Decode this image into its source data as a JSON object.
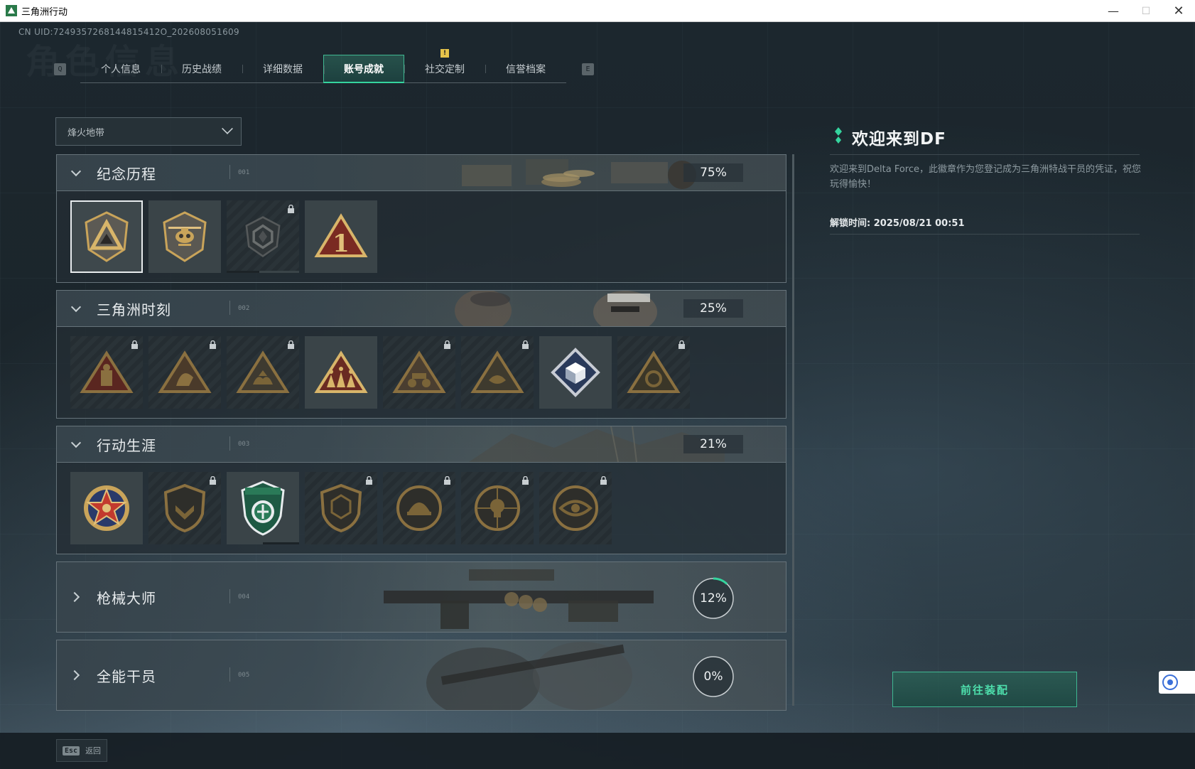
{
  "window": {
    "title": "三角洲行动",
    "controls": [
      "minimize-icon",
      "maximize-icon",
      "close-icon"
    ]
  },
  "uid": "CN UID:7249357268144815412O_202608051609",
  "background_title": "角色信息",
  "tabs": {
    "left_key": "Q",
    "right_key": "E",
    "items": [
      {
        "label": "个人信息",
        "active": false
      },
      {
        "label": "历史战绩",
        "active": false
      },
      {
        "label": "详细数据",
        "active": false
      },
      {
        "label": "账号成就",
        "active": true
      },
      {
        "label": "社交定制",
        "active": false,
        "alert": "!"
      },
      {
        "label": "信誉档案",
        "active": false
      }
    ]
  },
  "mode_select": {
    "value": "烽火地带"
  },
  "categories": [
    {
      "name": "纪念历程",
      "code": "001",
      "percent": "75%",
      "expanded": true,
      "badges": [
        {
          "icon": "delta-shield-badge-icon",
          "locked": false,
          "selected": true
        },
        {
          "icon": "helicopter-badge-icon",
          "locked": false
        },
        {
          "icon": "hex-emblem-badge-icon",
          "locked": true,
          "progress": 0.45
        },
        {
          "icon": "number-one-triangle-badge-icon",
          "locked": false
        }
      ]
    },
    {
      "name": "三角洲时刻",
      "code": "002",
      "percent": "25%",
      "expanded": true,
      "badges": [
        {
          "icon": "triangle-operator-badge-icon",
          "locked": true
        },
        {
          "icon": "triangle-runner-badge-icon",
          "locked": true
        },
        {
          "icon": "triangle-hands-badge-icon",
          "locked": true
        },
        {
          "icon": "triangle-squad-badge-icon",
          "locked": false
        },
        {
          "icon": "triangle-rider-badge-icon",
          "locked": true
        },
        {
          "icon": "triangle-fish-badge-icon",
          "locked": true
        },
        {
          "icon": "diamond-cube-badge-icon",
          "locked": false
        },
        {
          "icon": "triangle-mask-badge-icon",
          "locked": true
        }
      ]
    },
    {
      "name": "行动生涯",
      "code": "003",
      "percent": "21%",
      "expanded": true,
      "badges": [
        {
          "icon": "star-medal-badge-icon",
          "locked": false
        },
        {
          "icon": "shield-chevron-badge-icon",
          "locked": true
        },
        {
          "icon": "green-shield-badge-icon",
          "locked": false,
          "progress": 0.55
        },
        {
          "icon": "shield-hex-badge-icon",
          "locked": true
        },
        {
          "icon": "circle-helmet-badge-icon",
          "locked": true
        },
        {
          "icon": "circle-skull-badge-icon",
          "locked": true
        },
        {
          "icon": "circle-eye-badge-icon",
          "locked": true
        }
      ]
    },
    {
      "name": "枪械大师",
      "code": "004",
      "percent": "12%",
      "progress": 0.12,
      "expanded": false
    },
    {
      "name": "全能干员",
      "code": "005",
      "percent": "0%",
      "progress": 0,
      "expanded": false
    }
  ],
  "detail": {
    "title": "欢迎来到DF",
    "description": "欢迎来到Delta Force，此徽章作为您登记成为三角洲特战干员的凭证，祝您玩得愉快！",
    "unlock_label": "解锁时间: 2025/08/21 00:51",
    "equip_button": "前往装配"
  },
  "footer": {
    "esc_key": "Esc",
    "back_label": "返回"
  },
  "colors": {
    "accent": "#35d49e",
    "alert": "#e6c34a",
    "badge_gold": "#c9a45a",
    "badge_red": "#7a2a22"
  }
}
